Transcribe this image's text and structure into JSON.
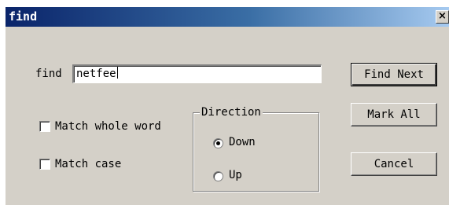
{
  "window": {
    "title": "find",
    "close_glyph": "×"
  },
  "find": {
    "label": "find",
    "value": "netfee"
  },
  "options": {
    "match_whole_word": {
      "label": "Match whole word",
      "checked": false
    },
    "match_case": {
      "label": "Match case",
      "checked": false
    }
  },
  "direction": {
    "title": "Direction",
    "down": {
      "label": "Down",
      "selected": true
    },
    "up": {
      "label": "Up",
      "selected": false
    }
  },
  "buttons": {
    "find_next": "Find Next",
    "mark_all": "Mark All",
    "cancel": "Cancel"
  },
  "colors": {
    "dialog_face": "#d4d0c8",
    "title_start": "#0a246a",
    "title_end": "#a6caf0"
  },
  "icons": {
    "close": "close-icon",
    "radio_selected": "radio-dot-icon"
  }
}
